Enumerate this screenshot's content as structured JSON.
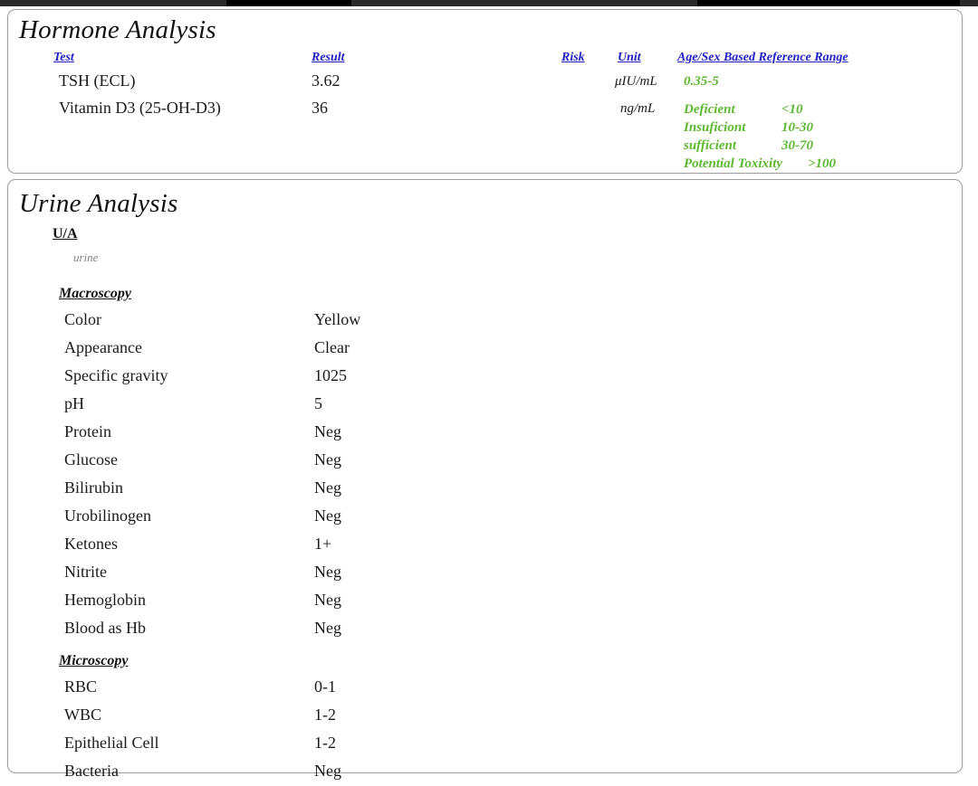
{
  "document": {
    "type": "laboratory-report"
  },
  "colors": {
    "header_blue": "#2020c4",
    "reference_green": "#5cb830",
    "specimen_grey": "#808080",
    "panel_border": "#9c9c9c",
    "text": "#1a1a1a"
  },
  "hormone": {
    "title": "Hormone Analysis",
    "columns": {
      "test": "Test",
      "result": "Result",
      "risk": "Risk",
      "unit": "Unit",
      "reference": "Age/Sex Based Reference Range"
    },
    "rows": [
      {
        "test": "TSH (ECL)",
        "result": "3.62",
        "risk": "",
        "unit": "μIU/mL",
        "reference_simple": "0.35-5"
      },
      {
        "test": "Vitamin D3 (25-OH-D3)",
        "result": "36",
        "risk": "",
        "unit": "ng/mL",
        "reference_lines": [
          {
            "label": "Deficient",
            "value": "<10"
          },
          {
            "label": "Insuficiont",
            "value": "10-30"
          },
          {
            "label": "sufficient",
            "value": "30-70"
          },
          {
            "label": "Potential Toxixity",
            "value": ">100"
          }
        ]
      }
    ]
  },
  "urine": {
    "title": "Urine Analysis",
    "panel_code": "U/A",
    "specimen": "urine",
    "groups": [
      {
        "heading": "Macroscopy",
        "rows": [
          {
            "label": "Color",
            "value": "Yellow"
          },
          {
            "label": "Appearance",
            "value": "Clear"
          },
          {
            "label": "Specific gravity",
            "value": "1025"
          },
          {
            "label": "pH",
            "value": "5"
          },
          {
            "label": "Protein",
            "value": "Neg"
          },
          {
            "label": "Glucose",
            "value": "Neg"
          },
          {
            "label": "Bilirubin",
            "value": "Neg"
          },
          {
            "label": "Urobilinogen",
            "value": "Neg"
          },
          {
            "label": "Ketones",
            "value": "1+"
          },
          {
            "label": "Nitrite",
            "value": "Neg"
          },
          {
            "label": "Hemoglobin",
            "value": "Neg"
          },
          {
            "label": "Blood as Hb",
            "value": "Neg"
          }
        ]
      },
      {
        "heading": "Microscopy",
        "rows": [
          {
            "label": "RBC",
            "value": "0-1"
          },
          {
            "label": "WBC",
            "value": "1-2"
          },
          {
            "label": "Epithelial Cell",
            "value": "1-2"
          },
          {
            "label": "Bacteria",
            "value": "Neg"
          }
        ]
      }
    ]
  }
}
